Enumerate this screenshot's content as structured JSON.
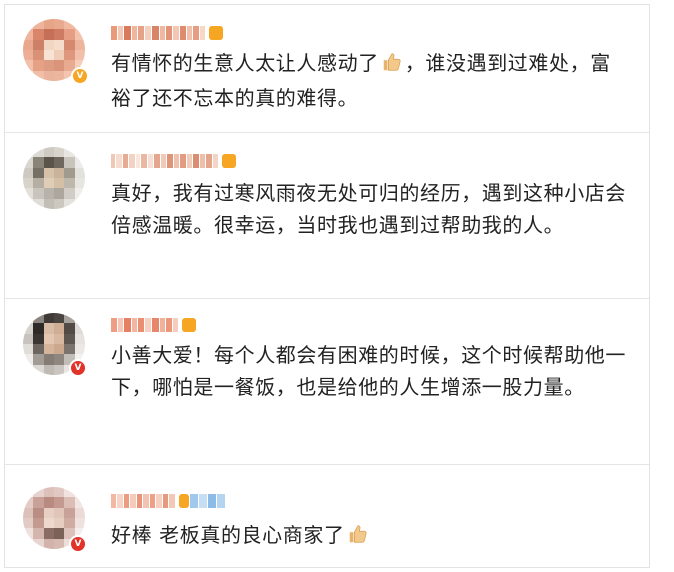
{
  "comments": [
    {
      "text_before": "有情怀的生意人太让人感动了",
      "emoji": "thumbs-up",
      "text_after": "，谁没遇到过难处，富裕了还不忘本的真的难得。"
    },
    {
      "text_before": "真好，我有过寒风雨夜无处可归的经历，遇到这种小店会倍感温暖。很幸运，当时我也遇到过帮助我的人。",
      "emoji": "",
      "text_after": ""
    },
    {
      "text_before": "小善大爱！每个人都会有困难的时候，这个时候帮助他一下，哪怕是一餐饭，也是给他的人生增添一股力量。",
      "emoji": "",
      "text_after": ""
    },
    {
      "text_before": "好棒 老板真的良心商家了",
      "emoji": "thumbs-up",
      "text_after": ""
    }
  ],
  "colors": {
    "text": "#222222",
    "divider": "#e6e6e6",
    "badge_orange": "#f6a623",
    "badge_red": "#e2332a"
  }
}
